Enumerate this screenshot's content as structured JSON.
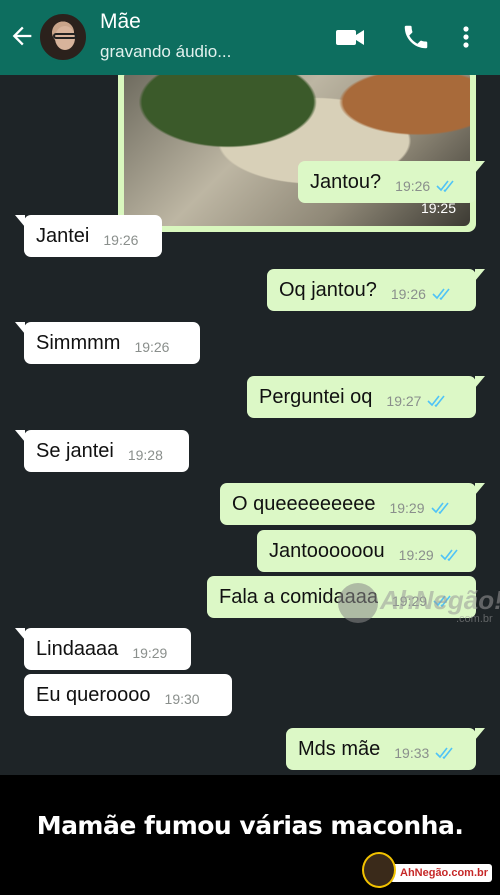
{
  "header": {
    "contact_name": "Mãe",
    "status": "gravando áudio...",
    "icons": [
      "back-arrow-icon",
      "video-call-icon",
      "phone-icon",
      "more-vert-icon"
    ],
    "color": "#0d6e5f"
  },
  "media_message": {
    "time": "19:25",
    "direction": "out",
    "read": true
  },
  "messages": [
    {
      "text": "Jantou?",
      "time": "19:26",
      "direction": "out"
    },
    {
      "text": "Jantei",
      "time": "19:26",
      "direction": "in"
    },
    {
      "text": "Oq jantou?",
      "time": "19:26",
      "direction": "out"
    },
    {
      "text": "Simmmm",
      "time": "19:26",
      "direction": "in"
    },
    {
      "text": "Perguntei oq",
      "time": "19:27",
      "direction": "out"
    },
    {
      "text": "Se jantei",
      "time": "19:28",
      "direction": "in"
    },
    {
      "text": "O queeeeeeeee",
      "time": "19:29",
      "direction": "out"
    },
    {
      "text": "Jantoooooou",
      "time": "19:29",
      "direction": "out"
    },
    {
      "text": "Fala a comidaaaa",
      "time": "19:29",
      "direction": "out"
    },
    {
      "text": "Lindaaaa",
      "time": "19:29",
      "direction": "in"
    },
    {
      "text": "Eu queroooo",
      "time": "19:30",
      "direction": "in"
    },
    {
      "text": "Mds mãe",
      "time": "19:33",
      "direction": "out"
    }
  ],
  "watermark": {
    "text": "AhNegão!",
    "sub": ".com.br"
  },
  "caption": "Mamãe fumou várias maconha.",
  "brand": "AhNegão.com.br",
  "colors": {
    "outgoing": "#dcf8c6",
    "incoming": "#ffffff",
    "chat_bg": "#1e2427",
    "read_ticks": "#4fc3f7"
  }
}
